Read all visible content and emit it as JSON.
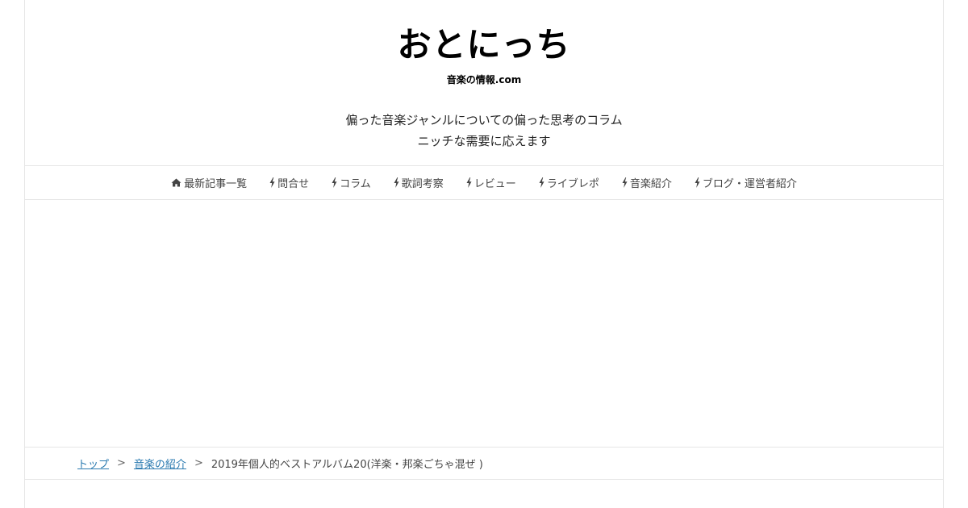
{
  "header": {
    "site_title": "おとにっち",
    "site_subtitle": "音楽の情報.com",
    "tagline_line1": "偏った音楽ジャンルについての偏った思考のコラム",
    "tagline_line2": "ニッチな需要に応えます"
  },
  "nav": {
    "items": [
      {
        "label": "最新記事一覧",
        "icon": "home-icon"
      },
      {
        "label": "問合せ",
        "icon": "bolt-icon"
      },
      {
        "label": "コラム",
        "icon": "bolt-icon"
      },
      {
        "label": "歌詞考察",
        "icon": "bolt-icon"
      },
      {
        "label": "レビュー",
        "icon": "bolt-icon"
      },
      {
        "label": "ライブレポ",
        "icon": "bolt-icon"
      },
      {
        "label": "音楽紹介",
        "icon": "bolt-icon"
      },
      {
        "label": "ブログ・運営者紹介",
        "icon": "bolt-icon"
      }
    ]
  },
  "breadcrumb": {
    "items": [
      "トップ",
      "音楽の紹介"
    ],
    "separator": ">",
    "current": "2019年個人的ベストアルバム20(洋楽・邦楽ごちゃ混ぜ )"
  },
  "colors": {
    "link": "#2a7ab0",
    "border": "#e6e6e6",
    "text": "#333333"
  }
}
